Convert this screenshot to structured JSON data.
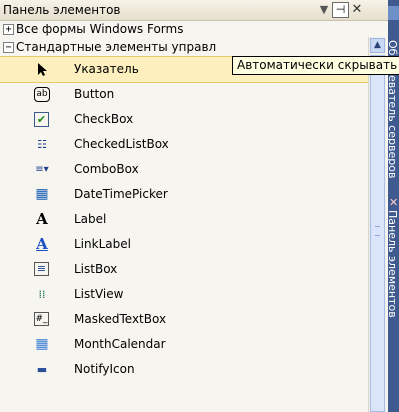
{
  "title": "Панель элементов",
  "controls": {
    "dropdown": "▼",
    "pin": "⊣",
    "close": "✕"
  },
  "categories": [
    {
      "expander": "+",
      "label": "Все формы Windows Forms"
    },
    {
      "expander": "−",
      "label": "Стандартные элементы управл"
    }
  ],
  "items": [
    {
      "label": "Указатель",
      "icon": "pointer-icon",
      "selected": true
    },
    {
      "label": "Button",
      "icon": "button-icon",
      "glyph": "ab"
    },
    {
      "label": "CheckBox",
      "icon": "checkbox-icon",
      "glyph": "✔"
    },
    {
      "label": "CheckedListBox",
      "icon": "checkedlistbox-icon",
      "glyph": "☷"
    },
    {
      "label": "ComboBox",
      "icon": "combobox-icon",
      "glyph": "≡▾"
    },
    {
      "label": "DateTimePicker",
      "icon": "datetimepicker-icon",
      "glyph": "▦"
    },
    {
      "label": "Label",
      "icon": "label-icon",
      "glyph": "A"
    },
    {
      "label": "LinkLabel",
      "icon": "linklabel-icon",
      "glyph": "A"
    },
    {
      "label": "ListBox",
      "icon": "listbox-icon",
      "glyph": "≡"
    },
    {
      "label": "ListView",
      "icon": "listview-icon",
      "glyph": "⁞⁞"
    },
    {
      "label": "MaskedTextBox",
      "icon": "maskedtextbox-icon",
      "glyph": "#_"
    },
    {
      "label": "MonthCalendar",
      "icon": "monthcalendar-icon",
      "glyph": "▦"
    },
    {
      "label": "NotifyIcon",
      "icon": "notifyicon-icon",
      "glyph": "▬"
    }
  ],
  "tooltip": "Автоматически скрывать",
  "side_tabs": [
    "Обозреватель серверов",
    "Панель элементов"
  ],
  "colors": {
    "selection": "#fdf0be",
    "side_bar": "#3e5a8f"
  }
}
